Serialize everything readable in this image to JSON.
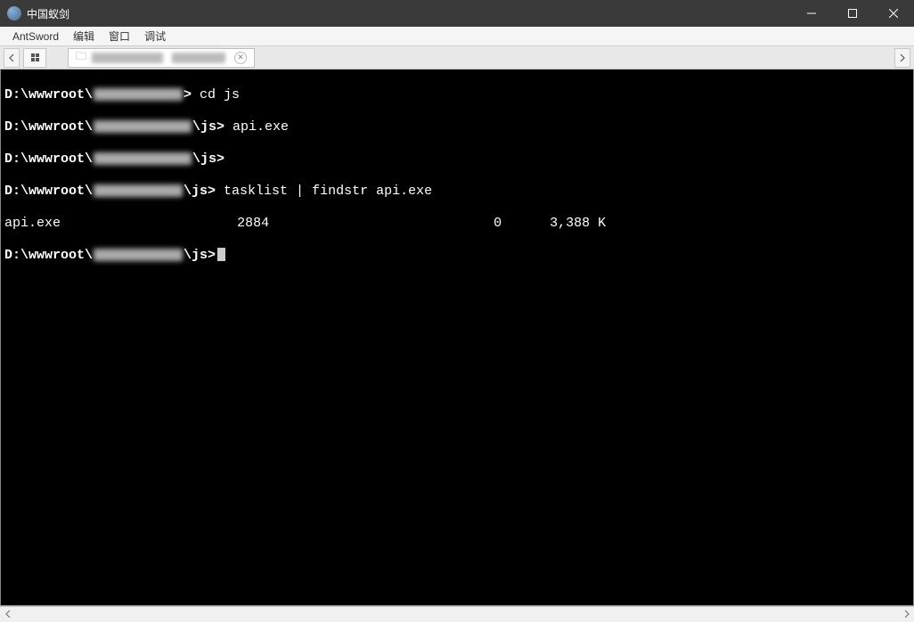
{
  "window": {
    "title": "中国蚁剑"
  },
  "menu": {
    "items": [
      "AntSword",
      "编辑",
      "窗口",
      "调试"
    ]
  },
  "tab": {
    "close_glyph": "✕"
  },
  "terminal": {
    "lines": [
      {
        "prompt_prefix": "D:\\wwwroot\\",
        "prompt_suffix": ">",
        "cmd": " cd js"
      },
      {
        "prompt_prefix": "D:\\wwwroot\\",
        "prompt_mid": "\\js>",
        "cmd": " api.exe"
      },
      {
        "prompt_prefix": "D:\\wwwroot\\",
        "prompt_mid": "\\js>",
        "cmd": ""
      },
      {
        "prompt_prefix": "D:\\wwwroot\\",
        "prompt_mid": "\\js>",
        "cmd": " tasklist | findstr api.exe"
      }
    ],
    "output": {
      "name": "api.exe",
      "pid": "2884",
      "session": "0",
      "mem": "3,388 K"
    },
    "prompt_last": {
      "prefix": "D:\\wwwroot\\",
      "mid": "\\js>"
    }
  }
}
